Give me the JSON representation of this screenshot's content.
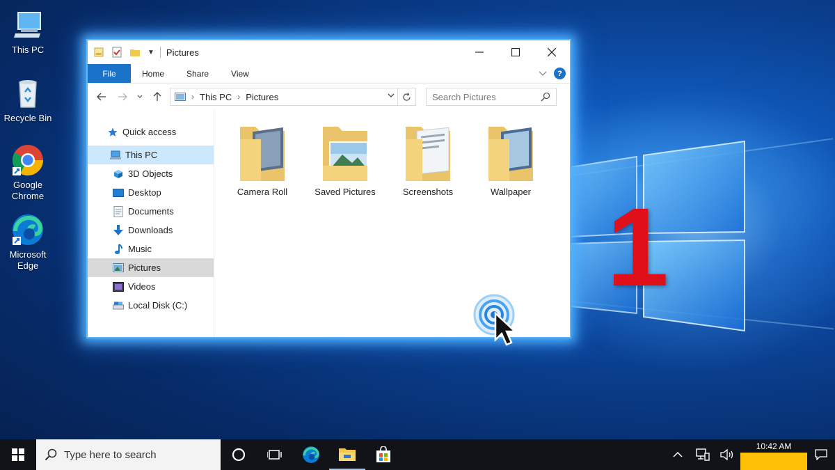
{
  "desktop": {
    "icons": [
      {
        "label": "This PC",
        "icon": "this-pc-icon"
      },
      {
        "label": "Recycle Bin",
        "icon": "recycle-bin-icon"
      },
      {
        "label": "Google Chrome",
        "icon": "chrome-icon"
      },
      {
        "label": "Microsoft Edge",
        "icon": "edge-icon"
      }
    ],
    "overlay_number": "1",
    "overlay_color": "#e0101a"
  },
  "window": {
    "title": "Pictures",
    "accent": "#1a73c9",
    "ribbon_tabs": {
      "file": "File",
      "home": "Home",
      "share": "Share",
      "view": "View"
    },
    "help": "?",
    "address": {
      "crumbs": [
        "This PC",
        "Pictures"
      ]
    },
    "search": {
      "placeholder": "Search Pictures"
    },
    "sidebar": [
      {
        "label": "Quick access",
        "icon": "star-icon"
      },
      {
        "label": "This PC",
        "icon": "pc-icon",
        "selected": true
      },
      {
        "label": "3D Objects",
        "icon": "cube-icon"
      },
      {
        "label": "Desktop",
        "icon": "desktop-icon"
      },
      {
        "label": "Documents",
        "icon": "documents-icon"
      },
      {
        "label": "Downloads",
        "icon": "download-arrow-icon"
      },
      {
        "label": "Music",
        "icon": "music-note-icon"
      },
      {
        "label": "Pictures",
        "icon": "pictures-icon",
        "selected": true
      },
      {
        "label": "Videos",
        "icon": "videos-icon"
      },
      {
        "label": "Local Disk (C:)",
        "icon": "disk-icon"
      }
    ],
    "folders": [
      {
        "label": "Camera Roll"
      },
      {
        "label": "Saved Pictures"
      },
      {
        "label": "Screenshots"
      },
      {
        "label": "Wallpaper"
      }
    ]
  },
  "taskbar": {
    "search_placeholder": "Type here to search",
    "clock": "10:42 AM",
    "clock_highlight": "#ffc107"
  }
}
